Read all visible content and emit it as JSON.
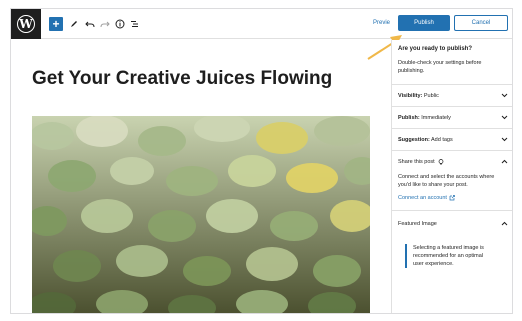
{
  "toolbar": {
    "add_label": "+",
    "preview_label": "Previe",
    "publish_label": "Publish",
    "cancel_label": "Cancel",
    "icons": [
      "pencil-icon",
      "undo-icon",
      "redo-icon",
      "info-icon",
      "list-view-icon"
    ]
  },
  "logo_letter": "W",
  "post": {
    "title": "Get Your Creative Juices Flowing"
  },
  "publish_panel": {
    "heading": "Are you ready to publish?",
    "subtext": "Double-check your settings before publishing.",
    "visibility": {
      "label": "Visibility:",
      "value": "Public"
    },
    "publish": {
      "label": "Publish:",
      "value": "Immediately"
    },
    "suggestion": {
      "label": "Suggestion:",
      "value": "Add tags"
    },
    "share": {
      "title": "Share this post",
      "text": "Connect and select the accounts where you'd like to share your post.",
      "link": "Connect an account"
    },
    "featured": {
      "title": "Featured Image",
      "notice": "Selecting a featured image is recommended for an optimal user experience."
    }
  },
  "colors": {
    "accent": "#2271b1",
    "arrow": "#f0b849"
  }
}
